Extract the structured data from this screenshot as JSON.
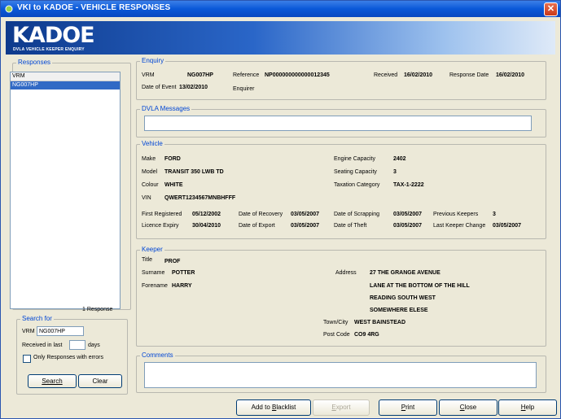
{
  "window": {
    "title": "VKI to KADOE - VEHICLE RESPONSES",
    "close": "✕"
  },
  "banner": {
    "logo": "KADOE",
    "subtitle": "DVLA VEHICLE KEEPER ENQUIRY"
  },
  "responses": {
    "legend": "Responses",
    "header": "VRM",
    "items": [
      "NG007HP"
    ],
    "count": "1 Response"
  },
  "search": {
    "legend": "Search for",
    "vrm_label": "VRM",
    "vrm_value": "NG007HP",
    "received_label": "Received in last",
    "received_value": "",
    "days_label": "days",
    "errors_label": "Only Responses with errors",
    "search_button": "Search",
    "clear_button": "Clear"
  },
  "enquiry": {
    "legend": "Enquiry",
    "vrm_label": "VRM",
    "vrm": "NG007HP",
    "reference_label": "Reference",
    "reference": "NP000000000000012345",
    "received_label": "Received",
    "received": "16/02/2010",
    "response_date_label": "Response Date",
    "response_date": "16/02/2010",
    "date_of_event_label": "Date of Event",
    "date_of_event": "13/02/2010",
    "enquirer_label": "Enquirer"
  },
  "dvla": {
    "legend": "DVLA Messages",
    "value": ""
  },
  "vehicle": {
    "legend": "Vehicle",
    "make_label": "Make",
    "make": "FORD",
    "model_label": "Model",
    "model": "TRANSIT 350 LWB TD",
    "colour_label": "Colour",
    "colour": "WHITE",
    "vin_label": "VIN",
    "vin": "QWERT1234567MNBHFFF",
    "engine_label": "Engine Capacity",
    "engine": "2402",
    "seating_label": "Seating Capacity",
    "seating": "3",
    "taxation_label": "Taxation Category",
    "taxation": "TAX-1-2222",
    "first_reg_label": "First Registered",
    "first_reg": "05/12/2002",
    "recovery_label": "Date of Recovery",
    "recovery": "03/05/2007",
    "scrapping_label": "Date of Scrapping",
    "scrapping": "03/05/2007",
    "prev_keepers_label": "Previous Keepers",
    "prev_keepers": "3",
    "licence_label": "Licence Expiry",
    "licence": "30/04/2010",
    "export_label": "Date of Export",
    "export": "03/05/2007",
    "theft_label": "Date of Theft",
    "theft": "03/05/2007",
    "last_keeper_label": "Last Keeper Change",
    "last_keeper": "03/05/2007"
  },
  "keeper": {
    "legend": "Keeper",
    "title_label": "Title",
    "title": "PROF",
    "surname_label": "Surname",
    "surname": "POTTER",
    "forename_label": "Forename",
    "forename": "HARRY",
    "address_label": "Address",
    "address": [
      "27 THE GRANGE AVENUE",
      "LANE AT THE BOTTOM OF THE HILL",
      "READING SOUTH WEST",
      "SOMEWHERE ELESE"
    ],
    "town_label": "Town/City",
    "town": "WEST BAINSTEAD",
    "postcode_label": "Post Code",
    "postcode": "CO9 4RG"
  },
  "comments": {
    "legend": "Comments",
    "value": ""
  },
  "buttons": {
    "blacklist_pre": "Add to ",
    "blacklist_u": "B",
    "blacklist_post": "lacklist",
    "export_u": "E",
    "export_post": "xport",
    "print_u": "P",
    "print_post": "rint",
    "close_u": "C",
    "close_post": "lose",
    "help_u": "H",
    "help_post": "elp"
  }
}
